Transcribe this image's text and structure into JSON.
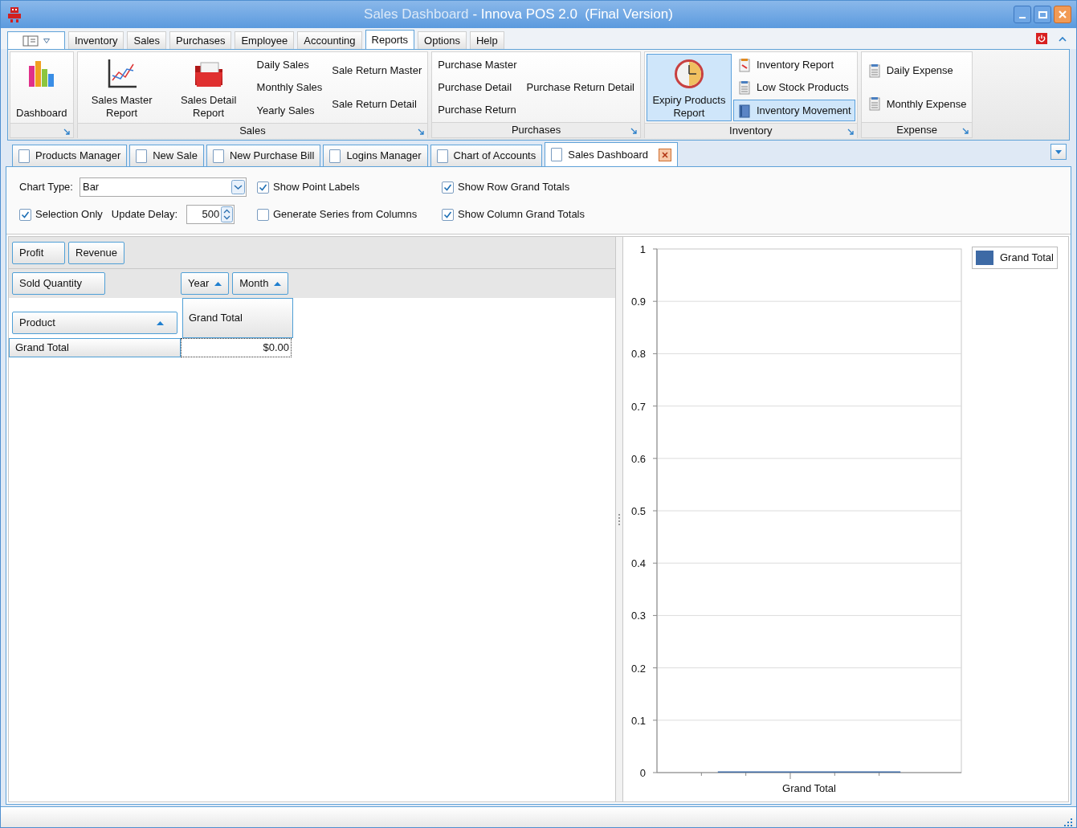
{
  "window": {
    "document": "Sales Dashboard",
    "app": "- Innova POS 2.0  (Final Version)"
  },
  "menu_tabs": [
    {
      "label": "Inventory",
      "selected": false
    },
    {
      "label": "Sales",
      "selected": false
    },
    {
      "label": "Purchases",
      "selected": false
    },
    {
      "label": "Employee",
      "selected": false
    },
    {
      "label": "Accounting",
      "selected": false
    },
    {
      "label": "Reports",
      "selected": true
    },
    {
      "label": "Options",
      "selected": false
    },
    {
      "label": "Help",
      "selected": false
    }
  ],
  "ribbon_groups": [
    {
      "columns": [
        [
          {
            "kind": "large",
            "label": "Dashboard",
            "highlighted": false
          }
        ]
      ]
    },
    {
      "label": "Sales",
      "columns": [
        [
          {
            "kind": "large",
            "label": "Sales Master Report",
            "highlighted": false
          }
        ],
        [
          {
            "kind": "large",
            "label": "Sales Detail Report",
            "highlighted": false
          }
        ],
        [
          {
            "kind": "small",
            "label": "Daily Sales",
            "highlighted": false
          },
          {
            "kind": "small",
            "label": "Monthly Sales",
            "highlighted": false
          },
          {
            "kind": "small",
            "label": "Yearly Sales",
            "highlighted": false
          }
        ],
        [
          {
            "kind": "small",
            "label": "Sale Return Master",
            "highlighted": false
          },
          {
            "kind": "small",
            "label": "Sale Return Detail",
            "highlighted": false
          }
        ]
      ]
    },
    {
      "label": "Purchases",
      "columns": [
        [
          {
            "kind": "small",
            "label": "Purchase Master",
            "highlighted": false
          },
          {
            "kind": "small",
            "label": "Purchase Detail",
            "highlighted": false
          },
          {
            "kind": "small",
            "label": "Purchase Return",
            "highlighted": false
          }
        ],
        [
          {
            "kind": "small",
            "label": "Purchase Return Detail",
            "highlighted": false
          }
        ]
      ]
    },
    {
      "label": "Inventory",
      "columns": [
        [
          {
            "kind": "large",
            "label": "Expiry Products Report",
            "highlighted": true
          }
        ],
        [
          {
            "kind": "small-icon",
            "label": "Inventory Report",
            "highlighted": false
          },
          {
            "kind": "small-icon",
            "label": "Low Stock Products",
            "highlighted": false
          },
          {
            "kind": "small-icon",
            "label": "Inventory Movement",
            "highlighted": true
          }
        ]
      ]
    },
    {
      "label": "Expense",
      "columns": [
        [
          {
            "kind": "small-icon",
            "label": "Daily Expense",
            "highlighted": false
          },
          {
            "kind": "small-icon",
            "label": "Monthly Expense",
            "highlighted": false
          }
        ]
      ]
    }
  ],
  "document_tabs": [
    {
      "label": "Products Manager",
      "selected": false
    },
    {
      "label": "New Sale",
      "selected": false
    },
    {
      "label": "New Purchase Bill",
      "selected": false
    },
    {
      "label": "Logins Manager",
      "selected": false
    },
    {
      "label": "Chart of Accounts",
      "selected": false
    },
    {
      "label": "Sales Dashboard",
      "selected": true
    }
  ],
  "options": {
    "chart_type_label": "Chart Type:",
    "chart_type_value": "Bar",
    "update_delay_label": "Update Delay:",
    "update_delay_value": "500",
    "checkboxes": [
      {
        "label": "Show Point Labels",
        "checked": true
      },
      {
        "label": "Show Row Grand Totals",
        "checked": true
      },
      {
        "label": "Selection Only",
        "checked": true
      },
      {
        "label": "Generate Series from Columns",
        "checked": false
      },
      {
        "label": "Show Column Grand Totals",
        "checked": true
      }
    ]
  },
  "pivot": {
    "filter_fields": [
      "Profit",
      "Revenue"
    ],
    "data_field": "Sold Quantity",
    "column_fields": [
      "Year",
      "Month"
    ],
    "row_field": "Product",
    "column_header": "Grand Total",
    "row_header": "Grand Total",
    "value": "$0.00"
  },
  "chart": {
    "chart_data": {
      "type": "bar",
      "grid": true,
      "categories": [
        "Grand Total"
      ],
      "series": [
        {
          "name": "Grand Total",
          "color": "#3d6aa5",
          "values": [
            0
          ]
        }
      ],
      "ylim": [
        0,
        1
      ],
      "yticks": [
        0,
        0.1,
        0.2,
        0.3,
        0.4,
        0.5,
        0.6,
        0.7,
        0.8,
        0.9,
        1
      ]
    }
  }
}
